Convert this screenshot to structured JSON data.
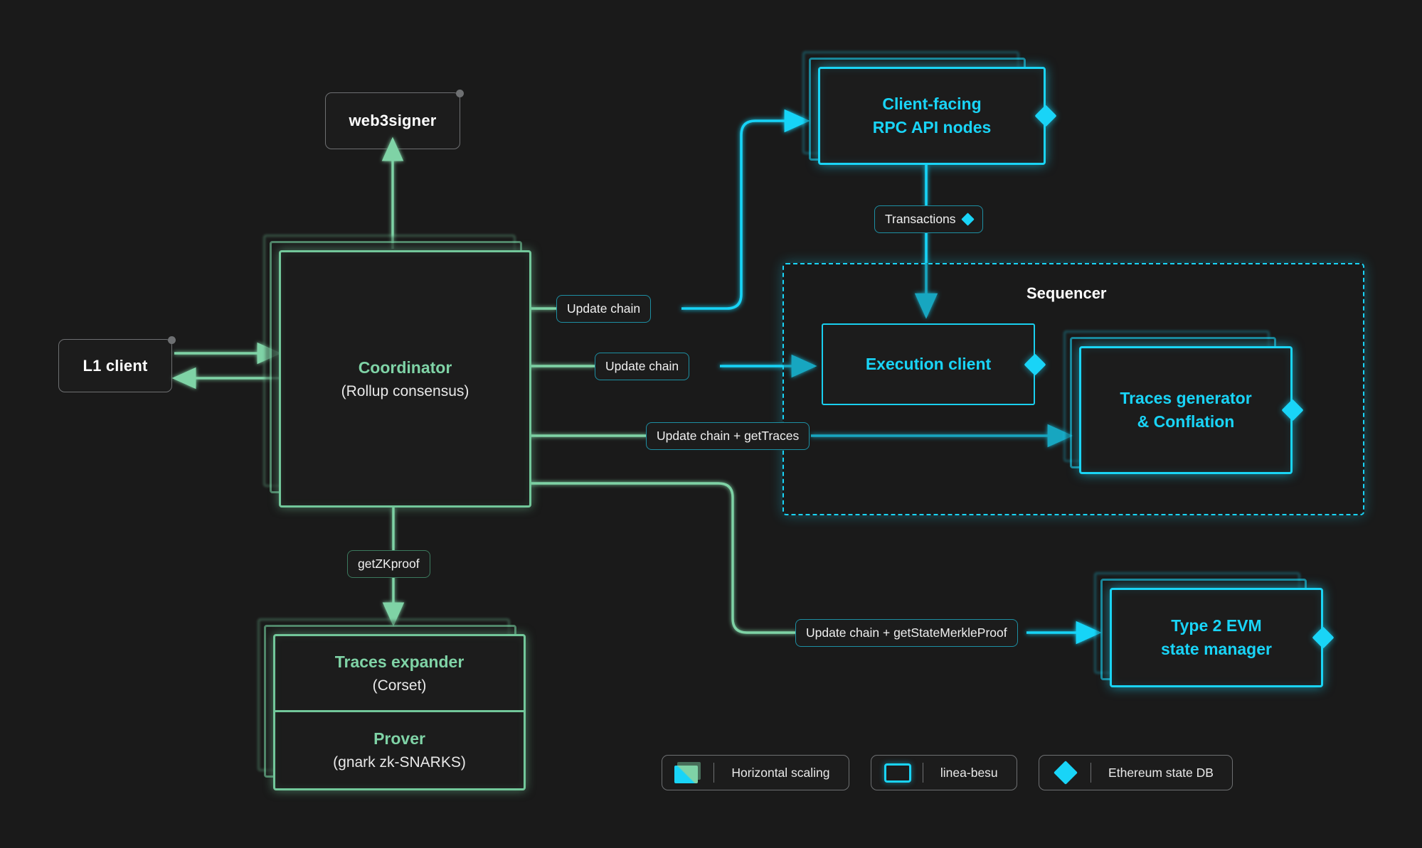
{
  "theme": {
    "background": "#1a1a1a",
    "green_accent": "#7fd3a6",
    "cyan_accent": "#19d4f7",
    "grey_border": "#6e7072",
    "node_fill": "#1c1c1c"
  },
  "nodes": {
    "web3signer": {
      "title": "web3signer"
    },
    "l1_client": {
      "title": "L1 client"
    },
    "coordinator": {
      "title": "Coordinator",
      "subtitle": "(Rollup consensus)"
    },
    "traces_expander": {
      "title": "Traces expander",
      "subtitle": "(Corset)"
    },
    "prover": {
      "title": "Prover",
      "subtitle": "(gnark zk-SNARKS)"
    },
    "rpc_nodes": {
      "line1": "Client-facing",
      "line2": "RPC API nodes"
    },
    "execution_client": {
      "title": "Execution client"
    },
    "traces_generator": {
      "line1": "Traces generator",
      "line2": "& Conflation"
    },
    "state_manager": {
      "line1": "Type 2 EVM",
      "line2": "state manager"
    }
  },
  "groups": {
    "sequencer": {
      "label": "Sequencer"
    }
  },
  "edge_labels": {
    "transactions": {
      "text": "Transactions",
      "has_diamond": true
    },
    "update_chain_rpc": {
      "text": "Update chain",
      "has_diamond": false
    },
    "update_chain_exec": {
      "text": "Update chain",
      "has_diamond": false
    },
    "update_chain_traces": {
      "text": "Update chain + getTraces",
      "has_diamond": false
    },
    "get_zk_proof": {
      "text": "getZKproof",
      "has_diamond": false
    },
    "update_chain_merkle": {
      "text": "Update chain + getStateMerkleProof",
      "has_diamond": false
    }
  },
  "legend": {
    "items": [
      {
        "icon": "horizontal-scaling-icon",
        "label": "Horizontal scaling"
      },
      {
        "icon": "linea-besu-icon",
        "label": "linea-besu"
      },
      {
        "icon": "ethereum-state-db-diamond-icon",
        "label": "Ethereum state DB"
      }
    ]
  }
}
